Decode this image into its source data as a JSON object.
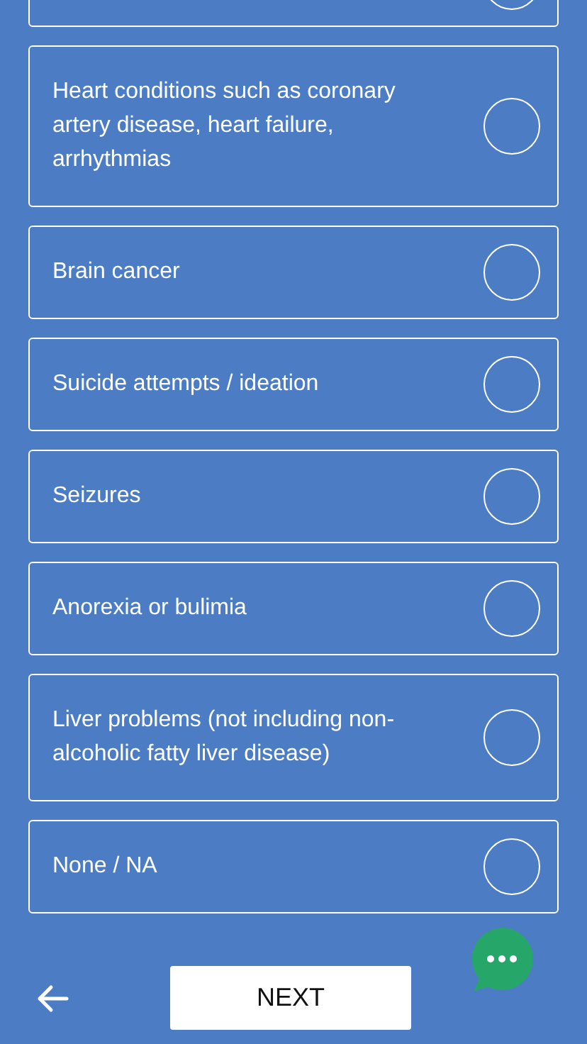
{
  "options": [
    {
      "kind": "clipped",
      "selected": false
    },
    {
      "kind": "option",
      "label": "Heart conditions such as coronary artery disease, heart failure, arrhythmias",
      "selected": false
    },
    {
      "kind": "option",
      "label": "Brain cancer",
      "selected": false
    },
    {
      "kind": "option",
      "label": "Suicide attempts / ideation",
      "selected": false
    },
    {
      "kind": "option",
      "label": "Seizures",
      "selected": false
    },
    {
      "kind": "option",
      "label": "Anorexia or bulimia",
      "selected": false
    },
    {
      "kind": "option",
      "label": "Liver problems (not including non-alcoholic fatty liver disease)",
      "selected": false
    },
    {
      "kind": "option",
      "label": "None / NA",
      "selected": false
    }
  ],
  "footer": {
    "next_button": "NEXT"
  }
}
